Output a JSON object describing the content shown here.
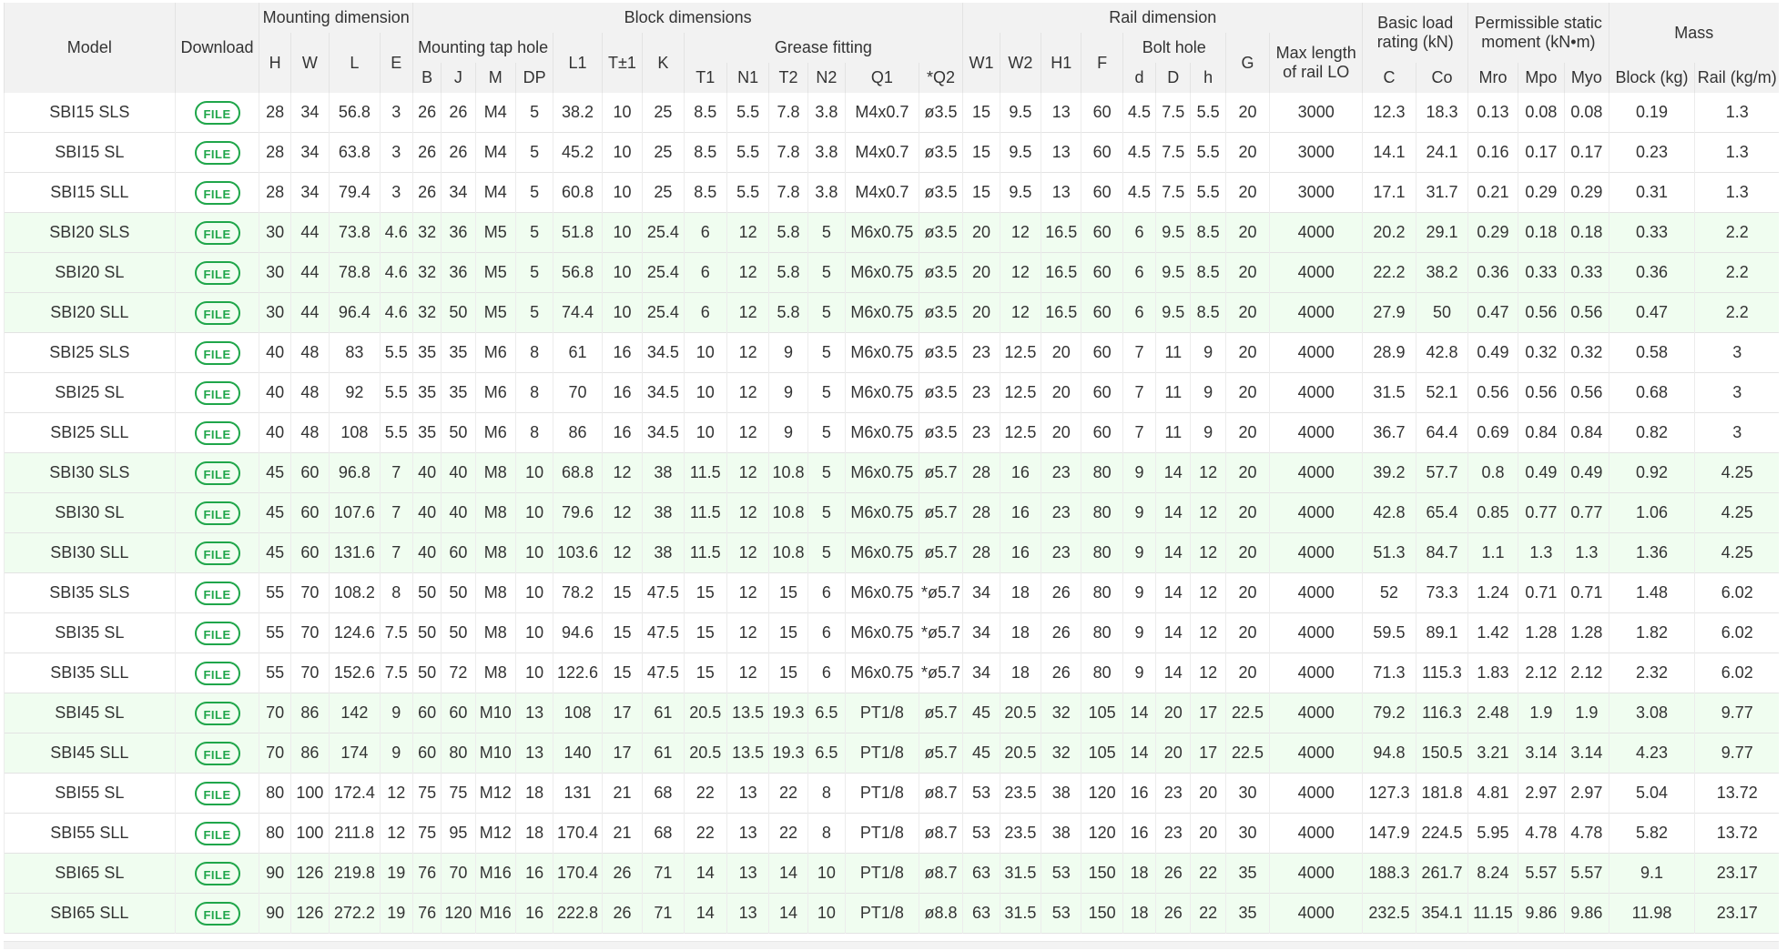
{
  "headers": {
    "model": "Model",
    "download": "Download",
    "mounting_dimension": "Mounting dimension",
    "block_dimensions": "Block dimensions",
    "rail_dimension": "Rail dimension",
    "basic_load": "Basic load rating (kN)",
    "static_moment": "Permissible static moment (kN•m)",
    "mass": "Mass",
    "mounting_tap_hole": "Mounting tap hole",
    "grease_fitting": "Grease fitting",
    "bolt_hole": "Bolt hole",
    "max_length": "Max length of rail LO",
    "H": "H",
    "W": "W",
    "L": "L",
    "E": "E",
    "B": "B",
    "J": "J",
    "M": "M",
    "DP": "DP",
    "L1": "L1",
    "T": "T±1",
    "K": "K",
    "T1": "T1",
    "N1": "N1",
    "T2": "T2",
    "N2": "N2",
    "Q1": "Q1",
    "Q2": "*Q2",
    "W1": "W1",
    "W2": "W2",
    "H1": "H1",
    "F": "F",
    "d": "d",
    "D": "D",
    "h": "h",
    "G": "G",
    "C": "C",
    "Co": "Co",
    "Mro": "Mro",
    "Mpo": "Mpo",
    "Myo": "Myo",
    "block_kg": "Block (kg)",
    "rail_kgm": "Rail (kg/m)"
  },
  "file_label": "FILE",
  "rows": [
    [
      "SBI15 SLS",
      "28",
      "34",
      "56.8",
      "3",
      "26",
      "26",
      "M4",
      "5",
      "38.2",
      "10",
      "25",
      "8.5",
      "5.5",
      "7.8",
      "3.8",
      "M4x0.7",
      "ø3.5",
      "15",
      "9.5",
      "13",
      "60",
      "4.5",
      "7.5",
      "5.5",
      "20",
      "3000",
      "12.3",
      "18.3",
      "0.13",
      "0.08",
      "0.08",
      "0.19",
      "1.3"
    ],
    [
      "SBI15 SL",
      "28",
      "34",
      "63.8",
      "3",
      "26",
      "26",
      "M4",
      "5",
      "45.2",
      "10",
      "25",
      "8.5",
      "5.5",
      "7.8",
      "3.8",
      "M4x0.7",
      "ø3.5",
      "15",
      "9.5",
      "13",
      "60",
      "4.5",
      "7.5",
      "5.5",
      "20",
      "3000",
      "14.1",
      "24.1",
      "0.16",
      "0.17",
      "0.17",
      "0.23",
      "1.3"
    ],
    [
      "SBI15 SLL",
      "28",
      "34",
      "79.4",
      "3",
      "26",
      "34",
      "M4",
      "5",
      "60.8",
      "10",
      "25",
      "8.5",
      "5.5",
      "7.8",
      "3.8",
      "M4x0.7",
      "ø3.5",
      "15",
      "9.5",
      "13",
      "60",
      "4.5",
      "7.5",
      "5.5",
      "20",
      "3000",
      "17.1",
      "31.7",
      "0.21",
      "0.29",
      "0.29",
      "0.31",
      "1.3"
    ],
    [
      "SBI20 SLS",
      "30",
      "44",
      "73.8",
      "4.6",
      "32",
      "36",
      "M5",
      "5",
      "51.8",
      "10",
      "25.4",
      "6",
      "12",
      "5.8",
      "5",
      "M6x0.75",
      "ø3.5",
      "20",
      "12",
      "16.5",
      "60",
      "6",
      "9.5",
      "8.5",
      "20",
      "4000",
      "20.2",
      "29.1",
      "0.29",
      "0.18",
      "0.18",
      "0.33",
      "2.2"
    ],
    [
      "SBI20 SL",
      "30",
      "44",
      "78.8",
      "4.6",
      "32",
      "36",
      "M5",
      "5",
      "56.8",
      "10",
      "25.4",
      "6",
      "12",
      "5.8",
      "5",
      "M6x0.75",
      "ø3.5",
      "20",
      "12",
      "16.5",
      "60",
      "6",
      "9.5",
      "8.5",
      "20",
      "4000",
      "22.2",
      "38.2",
      "0.36",
      "0.33",
      "0.33",
      "0.36",
      "2.2"
    ],
    [
      "SBI20 SLL",
      "30",
      "44",
      "96.4",
      "4.6",
      "32",
      "50",
      "M5",
      "5",
      "74.4",
      "10",
      "25.4",
      "6",
      "12",
      "5.8",
      "5",
      "M6x0.75",
      "ø3.5",
      "20",
      "12",
      "16.5",
      "60",
      "6",
      "9.5",
      "8.5",
      "20",
      "4000",
      "27.9",
      "50",
      "0.47",
      "0.56",
      "0.56",
      "0.47",
      "2.2"
    ],
    [
      "SBI25 SLS",
      "40",
      "48",
      "83",
      "5.5",
      "35",
      "35",
      "M6",
      "8",
      "61",
      "16",
      "34.5",
      "10",
      "12",
      "9",
      "5",
      "M6x0.75",
      "ø3.5",
      "23",
      "12.5",
      "20",
      "60",
      "7",
      "11",
      "9",
      "20",
      "4000",
      "28.9",
      "42.8",
      "0.49",
      "0.32",
      "0.32",
      "0.58",
      "3"
    ],
    [
      "SBI25 SL",
      "40",
      "48",
      "92",
      "5.5",
      "35",
      "35",
      "M6",
      "8",
      "70",
      "16",
      "34.5",
      "10",
      "12",
      "9",
      "5",
      "M6x0.75",
      "ø3.5",
      "23",
      "12.5",
      "20",
      "60",
      "7",
      "11",
      "9",
      "20",
      "4000",
      "31.5",
      "52.1",
      "0.56",
      "0.56",
      "0.56",
      "0.68",
      "3"
    ],
    [
      "SBI25 SLL",
      "40",
      "48",
      "108",
      "5.5",
      "35",
      "50",
      "M6",
      "8",
      "86",
      "16",
      "34.5",
      "10",
      "12",
      "9",
      "5",
      "M6x0.75",
      "ø3.5",
      "23",
      "12.5",
      "20",
      "60",
      "7",
      "11",
      "9",
      "20",
      "4000",
      "36.7",
      "64.4",
      "0.69",
      "0.84",
      "0.84",
      "0.82",
      "3"
    ],
    [
      "SBI30 SLS",
      "45",
      "60",
      "96.8",
      "7",
      "40",
      "40",
      "M8",
      "10",
      "68.8",
      "12",
      "38",
      "11.5",
      "12",
      "10.8",
      "5",
      "M6x0.75",
      "ø5.7",
      "28",
      "16",
      "23",
      "80",
      "9",
      "14",
      "12",
      "20",
      "4000",
      "39.2",
      "57.7",
      "0.8",
      "0.49",
      "0.49",
      "0.92",
      "4.25"
    ],
    [
      "SBI30 SL",
      "45",
      "60",
      "107.6",
      "7",
      "40",
      "40",
      "M8",
      "10",
      "79.6",
      "12",
      "38",
      "11.5",
      "12",
      "10.8",
      "5",
      "M6x0.75",
      "ø5.7",
      "28",
      "16",
      "23",
      "80",
      "9",
      "14",
      "12",
      "20",
      "4000",
      "42.8",
      "65.4",
      "0.85",
      "0.77",
      "0.77",
      "1.06",
      "4.25"
    ],
    [
      "SBI30 SLL",
      "45",
      "60",
      "131.6",
      "7",
      "40",
      "60",
      "M8",
      "10",
      "103.6",
      "12",
      "38",
      "11.5",
      "12",
      "10.8",
      "5",
      "M6x0.75",
      "ø5.7",
      "28",
      "16",
      "23",
      "80",
      "9",
      "14",
      "12",
      "20",
      "4000",
      "51.3",
      "84.7",
      "1.1",
      "1.3",
      "1.3",
      "1.36",
      "4.25"
    ],
    [
      "SBI35 SLS",
      "55",
      "70",
      "108.2",
      "8",
      "50",
      "50",
      "M8",
      "10",
      "78.2",
      "15",
      "47.5",
      "15",
      "12",
      "15",
      "6",
      "M6x0.75",
      "*ø5.7",
      "34",
      "18",
      "26",
      "80",
      "9",
      "14",
      "12",
      "20",
      "4000",
      "52",
      "73.3",
      "1.24",
      "0.71",
      "0.71",
      "1.48",
      "6.02"
    ],
    [
      "SBI35 SL",
      "55",
      "70",
      "124.6",
      "7.5",
      "50",
      "50",
      "M8",
      "10",
      "94.6",
      "15",
      "47.5",
      "15",
      "12",
      "15",
      "6",
      "M6x0.75",
      "*ø5.7",
      "34",
      "18",
      "26",
      "80",
      "9",
      "14",
      "12",
      "20",
      "4000",
      "59.5",
      "89.1",
      "1.42",
      "1.28",
      "1.28",
      "1.82",
      "6.02"
    ],
    [
      "SBI35 SLL",
      "55",
      "70",
      "152.6",
      "7.5",
      "50",
      "72",
      "M8",
      "10",
      "122.6",
      "15",
      "47.5",
      "15",
      "12",
      "15",
      "6",
      "M6x0.75",
      "*ø5.7",
      "34",
      "18",
      "26",
      "80",
      "9",
      "14",
      "12",
      "20",
      "4000",
      "71.3",
      "115.3",
      "1.83",
      "2.12",
      "2.12",
      "2.32",
      "6.02"
    ],
    [
      "SBI45 SL",
      "70",
      "86",
      "142",
      "9",
      "60",
      "60",
      "M10",
      "13",
      "108",
      "17",
      "61",
      "20.5",
      "13.5",
      "19.3",
      "6.5",
      "PT1/8",
      "ø5.7",
      "45",
      "20.5",
      "32",
      "105",
      "14",
      "20",
      "17",
      "22.5",
      "4000",
      "79.2",
      "116.3",
      "2.48",
      "1.9",
      "1.9",
      "3.08",
      "9.77"
    ],
    [
      "SBI45 SLL",
      "70",
      "86",
      "174",
      "9",
      "60",
      "80",
      "M10",
      "13",
      "140",
      "17",
      "61",
      "20.5",
      "13.5",
      "19.3",
      "6.5",
      "PT1/8",
      "ø5.7",
      "45",
      "20.5",
      "32",
      "105",
      "14",
      "20",
      "17",
      "22.5",
      "4000",
      "94.8",
      "150.5",
      "3.21",
      "3.14",
      "3.14",
      "4.23",
      "9.77"
    ],
    [
      "SBI55 SL",
      "80",
      "100",
      "172.4",
      "12",
      "75",
      "75",
      "M12",
      "18",
      "131",
      "21",
      "68",
      "22",
      "13",
      "22",
      "8",
      "PT1/8",
      "ø8.7",
      "53",
      "23.5",
      "38",
      "120",
      "16",
      "23",
      "20",
      "30",
      "4000",
      "127.3",
      "181.8",
      "4.81",
      "2.97",
      "2.97",
      "5.04",
      "13.72"
    ],
    [
      "SBI55 SLL",
      "80",
      "100",
      "211.8",
      "12",
      "75",
      "95",
      "M12",
      "18",
      "170.4",
      "21",
      "68",
      "22",
      "13",
      "22",
      "8",
      "PT1/8",
      "ø8.7",
      "53",
      "23.5",
      "38",
      "120",
      "16",
      "23",
      "20",
      "30",
      "4000",
      "147.9",
      "224.5",
      "5.95",
      "4.78",
      "4.78",
      "5.82",
      "13.72"
    ],
    [
      "SBI65 SL",
      "90",
      "126",
      "219.8",
      "19",
      "76",
      "70",
      "M16",
      "16",
      "170.4",
      "26",
      "71",
      "14",
      "13",
      "14",
      "10",
      "PT1/8",
      "ø8.7",
      "63",
      "31.5",
      "53",
      "150",
      "18",
      "26",
      "22",
      "35",
      "4000",
      "188.3",
      "261.7",
      "8.24",
      "5.57",
      "5.57",
      "9.1",
      "23.17"
    ],
    [
      "SBI65 SLL",
      "90",
      "126",
      "272.2",
      "19",
      "76",
      "120",
      "M16",
      "16",
      "222.8",
      "26",
      "71",
      "14",
      "13",
      "14",
      "10",
      "PT1/8",
      "ø8.8",
      "63",
      "31.5",
      "53",
      "150",
      "18",
      "26",
      "22",
      "35",
      "4000",
      "232.5",
      "354.1",
      "11.15",
      "9.86",
      "9.86",
      "11.98",
      "23.17"
    ]
  ],
  "row_groups": [
    "even",
    "even",
    "even",
    "odd",
    "odd",
    "odd",
    "even",
    "even",
    "even",
    "odd",
    "odd",
    "odd",
    "even",
    "even",
    "even",
    "odd",
    "odd",
    "even",
    "even",
    "odd",
    "odd"
  ]
}
